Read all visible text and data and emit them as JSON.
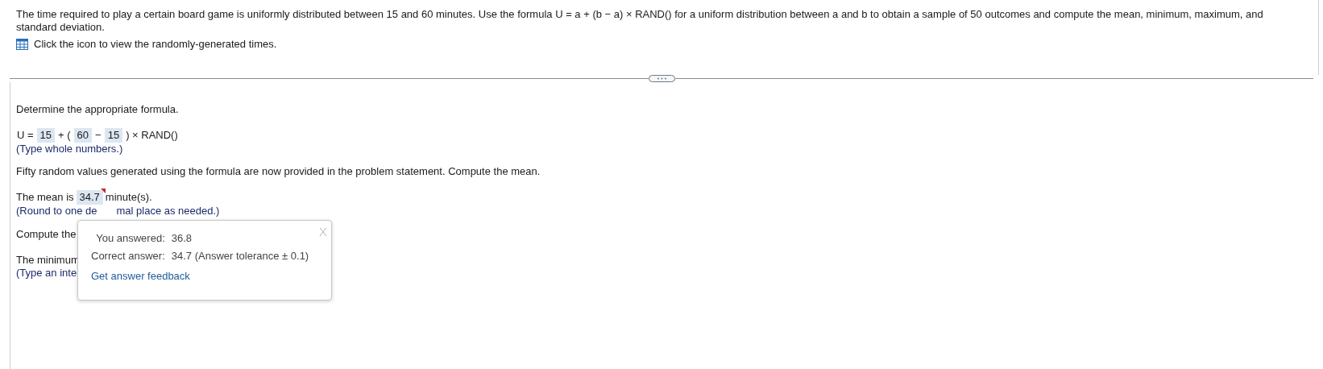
{
  "problem": {
    "text": "The time required to play a certain board game is uniformly distributed between 15 and 60 minutes. Use the formula U = a + (b − a) × RAND() for a uniform distribution between a and b to obtain a sample of 50 outcomes and compute the mean, minimum, maximum, and standard deviation.",
    "data_link": "Click the icon to view the randomly-generated times."
  },
  "formula_step": {
    "prompt": "Determine the appropriate formula.",
    "parts": [
      {
        "kind": "text",
        "text": "U ="
      },
      {
        "kind": "answer",
        "text": "15"
      },
      {
        "kind": "text",
        "text": "+ ("
      },
      {
        "kind": "answer",
        "text": "60"
      },
      {
        "kind": "text",
        "text": "−"
      },
      {
        "kind": "answer",
        "text": "15"
      },
      {
        "kind": "text",
        "text": ") × RAND()"
      }
    ],
    "hint": "(Type whole numbers.)"
  },
  "mean_step": {
    "prompt": "Fifty random values generated using the formula are now provided in the problem statement. Compute the mean.",
    "before": "The mean is",
    "answer": "34.7",
    "after": "minute(s).",
    "incorrect": true,
    "hint_parts": [
      "(Round to one de",
      "mal place as needed.)"
    ]
  },
  "covered_lines": [
    {
      "kind": "prompt",
      "text": "Compute the"
    },
    {
      "kind": "answer_line",
      "text": "The minimum"
    },
    {
      "kind": "hint",
      "text": "(Type an inte"
    }
  ],
  "feedback_popup": {
    "close": "X",
    "rows": [
      {
        "label": "You answered:",
        "value": "36.8"
      },
      {
        "label": "Correct answer:",
        "value": "34.7 (Answer tolerance ± 0.1)"
      }
    ],
    "link": "Get answer feedback"
  }
}
